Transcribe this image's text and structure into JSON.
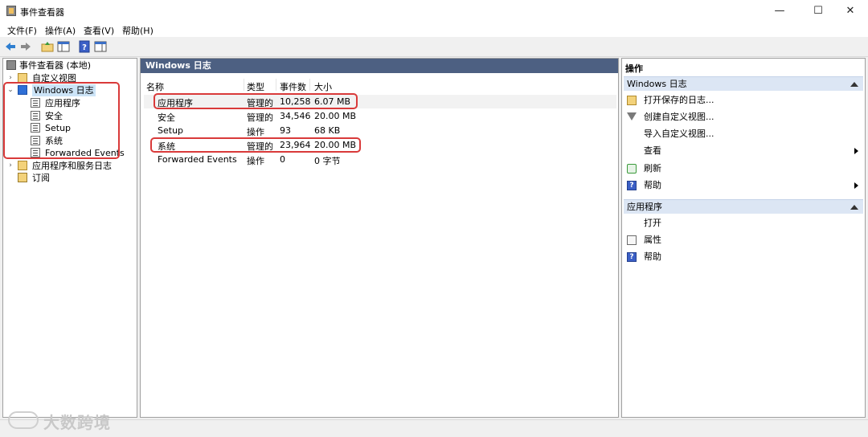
{
  "window": {
    "title": "事件查看器",
    "minimize_glyph": "—",
    "maximize_glyph": "☐",
    "close_glyph": "✕"
  },
  "menu": [
    "文件(F)",
    "操作(A)",
    "查看(V)",
    "帮助(H)"
  ],
  "toolbar": {
    "icons": [
      "back-arrow-icon",
      "forward-arrow-icon",
      "up-folder-icon",
      "show-hide-tree-icon",
      "help-icon",
      "console-pane-icon"
    ]
  },
  "tree": {
    "root": "事件查看器 (本地)",
    "custom_views": "自定义视图",
    "windows_logs": "Windows 日志",
    "children": [
      "应用程序",
      "安全",
      "Setup",
      "系统",
      "Forwarded Events"
    ],
    "apps_services": "应用程序和服务日志",
    "subscriptions": "订阅"
  },
  "center": {
    "header": "Windows 日志",
    "columns": [
      "名称",
      "类型",
      "事件数",
      "大小"
    ],
    "rows": [
      {
        "name": "应用程序",
        "type": "管理的",
        "count": "10,258",
        "size": "6.07 MB"
      },
      {
        "name": "安全",
        "type": "管理的",
        "count": "34,546",
        "size": "20.00 MB"
      },
      {
        "name": "Setup",
        "type": "操作",
        "count": "93",
        "size": "68 KB"
      },
      {
        "name": "系统",
        "type": "管理的",
        "count": "23,964",
        "size": "20.00 MB"
      },
      {
        "name": "Forwarded Events",
        "type": "操作",
        "count": "0",
        "size": "0 字节"
      }
    ]
  },
  "actions": {
    "title": "操作",
    "section1": {
      "header": "Windows 日志",
      "items": [
        "打开保存的日志...",
        "创建自定义视图...",
        "导入自定义视图...",
        "查看",
        "刷新",
        "帮助"
      ]
    },
    "section2": {
      "header": "应用程序",
      "items": [
        "打开",
        "属性",
        "帮助"
      ]
    }
  },
  "watermark": "大数跨境",
  "colors": {
    "header_bg": "#4d6082",
    "section_bg": "#dce6f4",
    "highlight": "#d93a3a",
    "selected_tree": "#cce4f7"
  }
}
